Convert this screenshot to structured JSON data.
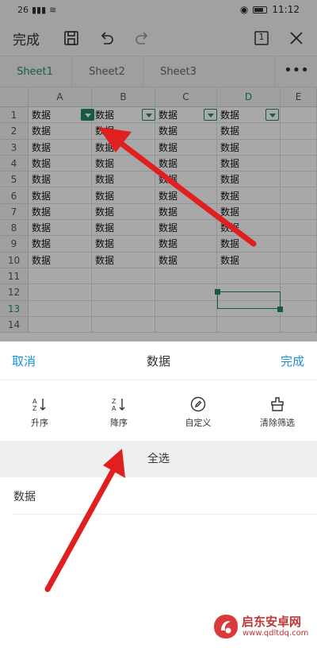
{
  "status_bar": {
    "signal": "26",
    "time": "11:12"
  },
  "toolbar": {
    "done_label": "完成",
    "page_count": "1"
  },
  "sheet_tabs": [
    "Sheet1",
    "Sheet2",
    "Sheet3"
  ],
  "columns": [
    "A",
    "B",
    "C",
    "D",
    "E"
  ],
  "rows": [
    "1",
    "2",
    "3",
    "4",
    "5",
    "6",
    "7",
    "8",
    "9",
    "10",
    "11",
    "12",
    "13",
    "14"
  ],
  "cell_text": "数据",
  "filter_panel": {
    "cancel_label": "取消",
    "title": "数据",
    "done_label": "完成",
    "actions": [
      "升序",
      "降序",
      "自定义",
      "清除筛选"
    ],
    "select_all_label": "全选",
    "values": [
      "数据"
    ]
  },
  "watermark": {
    "name": "启东安卓网",
    "url": "www.qdltdq.com"
  },
  "colors": {
    "accent_green": "#1f8a64",
    "link_blue": "#1a8fd6",
    "arrow_red": "#e02020"
  }
}
